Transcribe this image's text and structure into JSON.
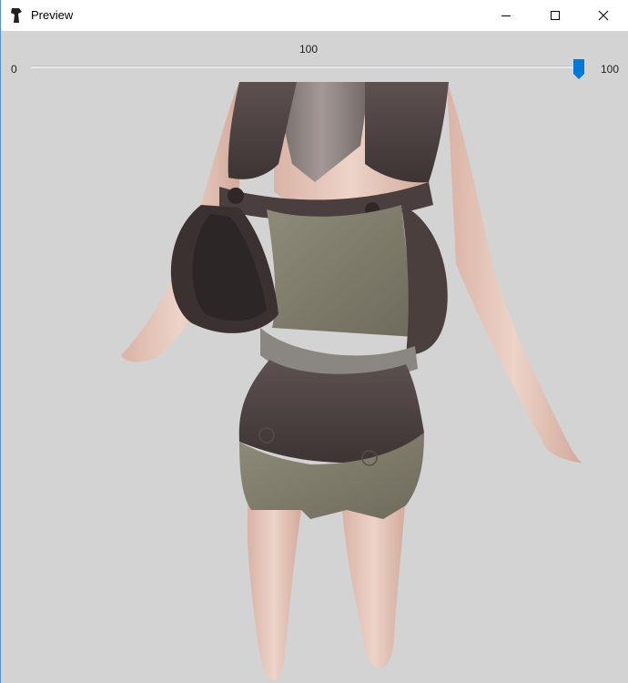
{
  "window": {
    "title": "Preview",
    "app_icon": "app-icon",
    "controls": {
      "minimize_icon": "minimize-icon",
      "maximize_icon": "maximize-icon",
      "close_icon": "close-icon"
    }
  },
  "slider": {
    "min": "0",
    "max": "100",
    "value": "100",
    "value_fraction": 1.0,
    "accent_color": "#0078d7"
  },
  "viewport": {
    "background_color": "#d3d3d3"
  }
}
